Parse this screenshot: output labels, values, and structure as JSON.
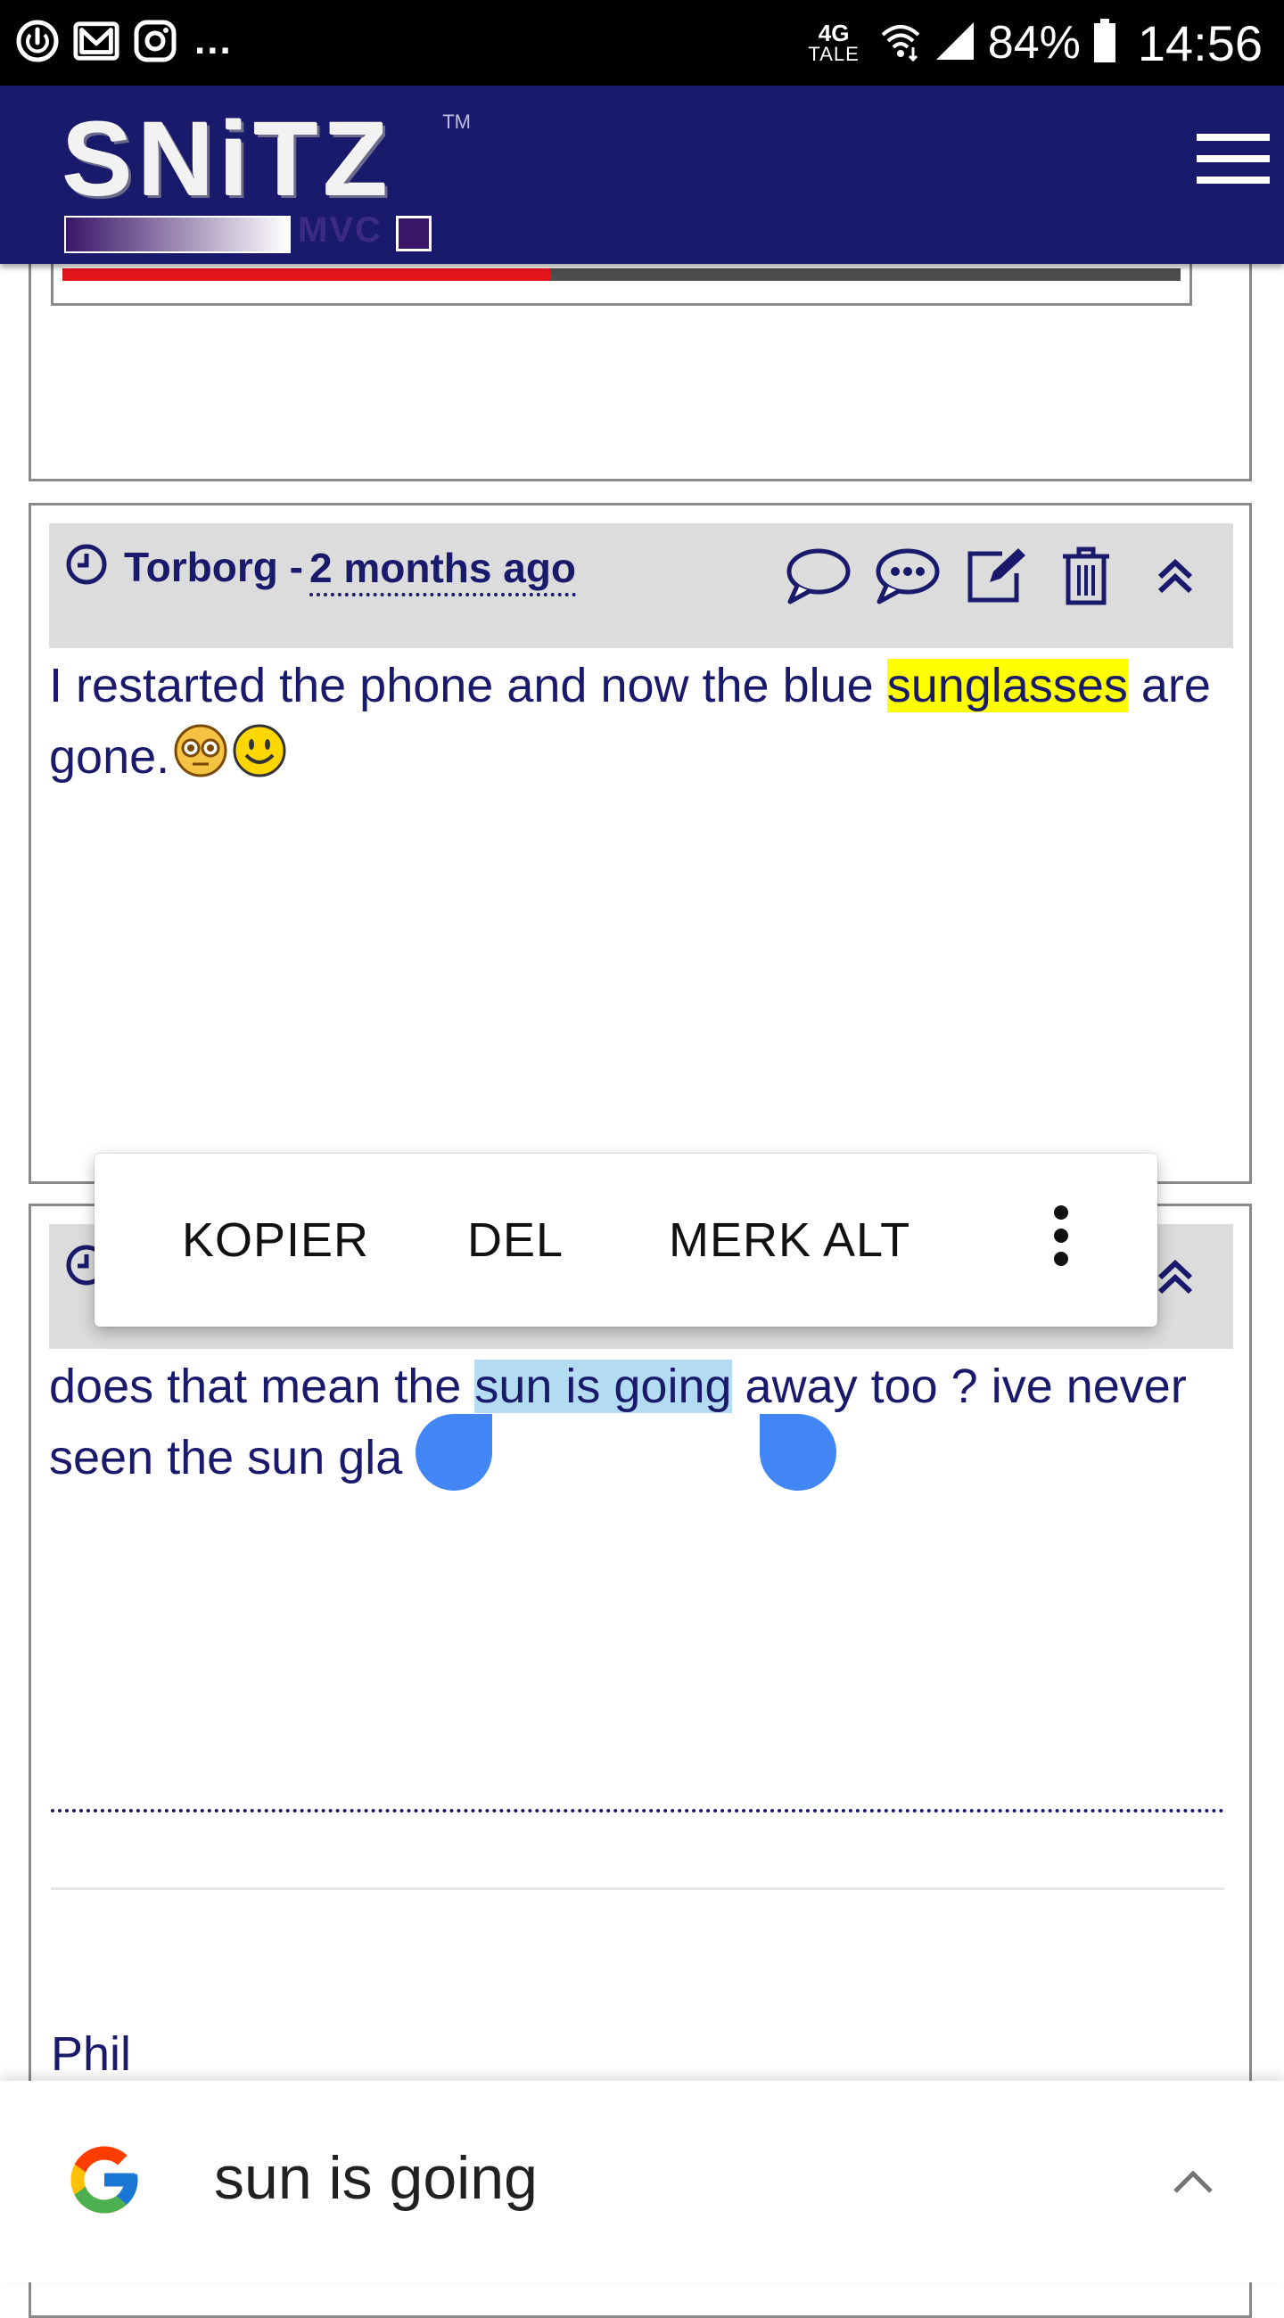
{
  "status_bar": {
    "network_type": "4G",
    "network_sub": "TALE",
    "battery_percent": "84%",
    "time": "14:56",
    "overflow_indicator": "...",
    "icons": [
      "power-icon",
      "gmail-icon",
      "instagram-icon",
      "wifi-icon",
      "signal-icon",
      "battery-icon"
    ]
  },
  "header": {
    "logo_text": "SNiTZ",
    "logo_sub": "MVC",
    "logo_tm": "TM",
    "menu_icon": "hamburger-menu-icon",
    "bg_color": "#1a1a6c"
  },
  "posts": [
    {
      "author": "Torborg -",
      "time_ago": " 2 months ago ",
      "body_before": "I restarted the phone and now the blue ",
      "body_highlight": "sunglasses",
      "body_after": " are gone.",
      "emoticons": [
        "sunglasses-smiley-icon",
        "smiley-icon"
      ],
      "actions": [
        "reply-icon",
        "quote-icon",
        "edit-icon",
        "delete-icon",
        "scroll-top-icon"
      ]
    },
    {
      "body_before": "does that mean the ",
      "body_selected": "sun is going",
      "body_after": " away too ? ive never seen the sun gla",
      "body_end": "s.",
      "signature": "Phil",
      "actions": [
        "scroll-top-icon"
      ]
    }
  ],
  "context_menu": {
    "copy": "KOPIER",
    "share": "DEL",
    "select_all": "MERK ALT",
    "more_icon": "more-vert-icon"
  },
  "google_bar": {
    "query": "sun is going",
    "expand_icon": "chevron-up-icon"
  },
  "colors": {
    "text": "#1a1a6c",
    "highlight": "#ffff00",
    "selection": "#b3dcf2",
    "handle": "#4285f4"
  }
}
